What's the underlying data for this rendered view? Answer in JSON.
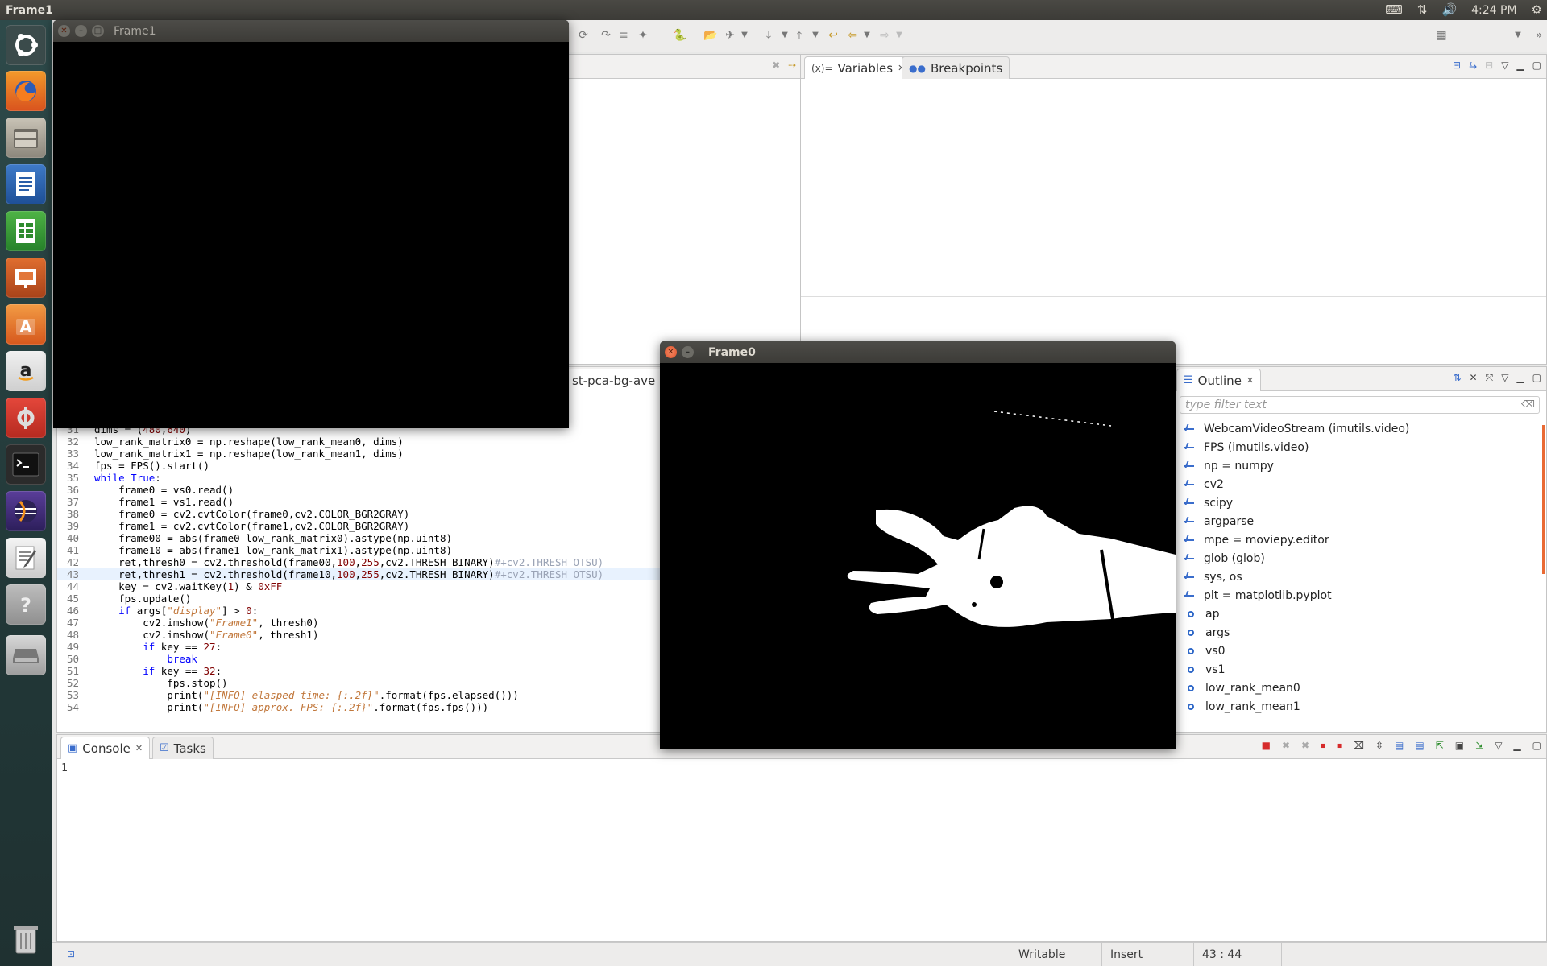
{
  "system": {
    "active_app": "Frame1",
    "time": "4:24 PM"
  },
  "toolbar": {
    "icons": [
      "new-icon",
      "save-icon",
      "python-icon",
      "open-icon",
      "run-icon",
      "debug-icon",
      "back-icon",
      "forward-icon",
      "perspective-icon"
    ]
  },
  "editor": {
    "tab_label": "st-pca-bg-ave",
    "lines": [
      {
        "n": "31",
        "t": "dims = (480,640)"
      },
      {
        "n": "32",
        "t": "low_rank_matrix0 = np.reshape(low_rank_mean0, dims)"
      },
      {
        "n": "33",
        "t": "low_rank_matrix1 = np.reshape(low_rank_mean1, dims)"
      },
      {
        "n": "34",
        "t": "fps = FPS().start()"
      },
      {
        "n": "35",
        "t": "while True:"
      },
      {
        "n": "36",
        "t": "    frame0 = vs0.read()"
      },
      {
        "n": "37",
        "t": "    frame1 = vs1.read()"
      },
      {
        "n": "38",
        "t": "    frame0 = cv2.cvtColor(frame0,cv2.COLOR_BGR2GRAY)"
      },
      {
        "n": "39",
        "t": "    frame1 = cv2.cvtColor(frame1,cv2.COLOR_BGR2GRAY)"
      },
      {
        "n": "40",
        "t": "    frame00 = abs(frame0-low_rank_matrix0).astype(np.uint8)"
      },
      {
        "n": "41",
        "t": "    frame10 = abs(frame1-low_rank_matrix1).astype(np.uint8)"
      },
      {
        "n": "42",
        "t": "    ret,thresh0 = cv2.threshold(frame00,100,255,cv2.THRESH_BINARY)#+cv2.THRESH_OTSU)"
      },
      {
        "n": "43",
        "t": "    ret,thresh1 = cv2.threshold(frame10,100,255,cv2.THRESH_BINARY)#+cv2.THRESH_OTSU)"
      },
      {
        "n": "44",
        "t": "    key = cv2.waitKey(1) & 0xFF"
      },
      {
        "n": "45",
        "t": "    fps.update()"
      },
      {
        "n": "46",
        "t": "    if args[\"display\"] > 0:"
      },
      {
        "n": "47",
        "t": "        cv2.imshow(\"Frame1\", thresh0)"
      },
      {
        "n": "48",
        "t": "        cv2.imshow(\"Frame0\", thresh1)"
      },
      {
        "n": "49",
        "t": "        if key == 27:"
      },
      {
        "n": "50",
        "t": "            break"
      },
      {
        "n": "51",
        "t": "        if key == 32:"
      },
      {
        "n": "52",
        "t": "            fps.stop()"
      },
      {
        "n": "53",
        "t": "            print(\"[INFO] elasped time: {:.2f}\".format(fps.elapsed()))"
      },
      {
        "n": "54",
        "t": "            print(\"[INFO] approx. FPS: {:.2f}\".format(fps.fps()))"
      }
    ]
  },
  "variables_panel": {
    "tab_variables": "Variables",
    "tab_breakpoints": "Breakpoints"
  },
  "outline": {
    "tab_label": "Outline",
    "filter_placeholder": "type filter text",
    "items": [
      {
        "label": "WebcamVideoStream (imutils.video)",
        "kind": "import"
      },
      {
        "label": "FPS (imutils.video)",
        "kind": "import"
      },
      {
        "label": "np = numpy",
        "kind": "import"
      },
      {
        "label": "cv2",
        "kind": "import"
      },
      {
        "label": "scipy",
        "kind": "import"
      },
      {
        "label": "argparse",
        "kind": "import"
      },
      {
        "label": "mpe = moviepy.editor",
        "kind": "import"
      },
      {
        "label": "glob (glob)",
        "kind": "import"
      },
      {
        "label": "sys, os",
        "kind": "import"
      },
      {
        "label": "plt = matplotlib.pyplot",
        "kind": "import"
      },
      {
        "label": "ap",
        "kind": "variable"
      },
      {
        "label": "args",
        "kind": "variable"
      },
      {
        "label": "vs0",
        "kind": "variable"
      },
      {
        "label": "vs1",
        "kind": "variable"
      },
      {
        "label": "low_rank_mean0",
        "kind": "variable"
      },
      {
        "label": "low_rank_mean1",
        "kind": "variable"
      }
    ]
  },
  "console": {
    "tab_console": "Console",
    "tab_tasks": "Tasks",
    "output": "1"
  },
  "statusbar": {
    "mode": "Writable",
    "insert": "Insert",
    "position": "43 : 44"
  },
  "windows": {
    "frame1_title": "Frame1",
    "frame0_title": "Frame0"
  }
}
